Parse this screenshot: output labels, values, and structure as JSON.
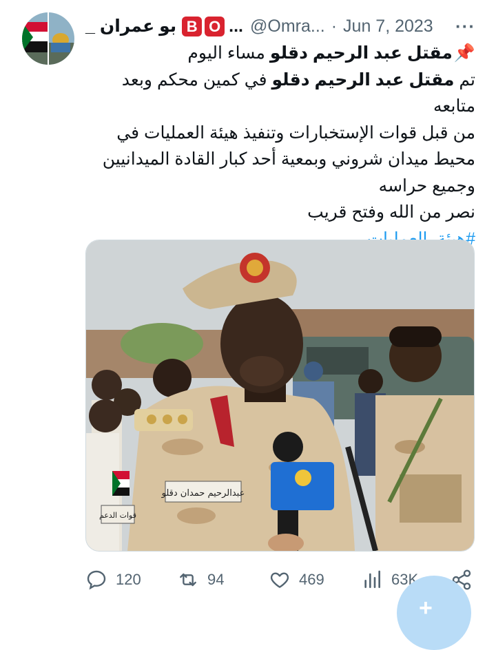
{
  "tweet": {
    "author": {
      "name": "بو عمران _",
      "badge_letters": [
        "B",
        "O"
      ],
      "name_ellipsis": "...",
      "handle": "@Omra...",
      "separator": "·",
      "date": "Jun 7, 2023",
      "more_label": "···"
    },
    "lines": {
      "l1_pin": "📌",
      "l1_bold": "مقتل عبد الرحيم دقلو",
      "l1_rest": " مساء اليوم",
      "l2_pre": "تم ",
      "l2_bold": "مقتل عبد الرحيم دقلو",
      "l2_rest": " في كمين محكم وبعد متابعه",
      "l3": "من قبل قوات الإستخبارات وتنفيذ هيئة العمليات في",
      "l4": "محيط ميدان شروني وبمعية أحد كبار القادة الميدانيين",
      "l5": "وجميع حراسه",
      "l6": "نصر من الله وفتح قريب",
      "hashtag": "#هيئة_العمليات"
    },
    "media": {
      "name_tag": "عبدالرحيم حمدان دقلو",
      "sleeve_tag": "قوات الدعم",
      "colors": {
        "uniform": "#d8c3a0",
        "camo": "#c1a27a",
        "beret": "#cbb690",
        "sky": "#cfd4d6",
        "vehicle": "#5b6f67",
        "mic": "#1f6fd3"
      }
    },
    "actions": {
      "replies": "120",
      "retweets": "94",
      "likes": "469",
      "views": "63K"
    },
    "colors": {
      "accent": "#1d9bf0",
      "muted": "#536471",
      "badge": "#d9232f"
    }
  }
}
